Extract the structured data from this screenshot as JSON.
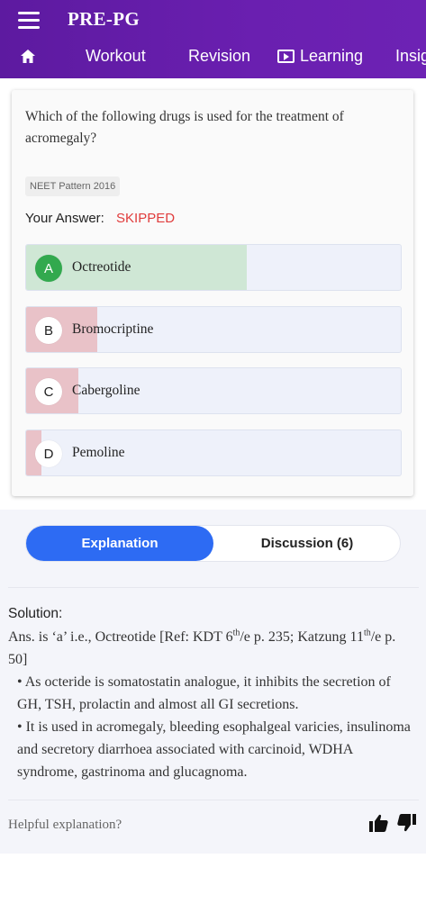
{
  "header": {
    "title": "PRE-PG",
    "tabs": [
      {
        "icon": "home-icon",
        "label": ""
      },
      {
        "label": "Workout"
      },
      {
        "label": "Revision"
      },
      {
        "icon": "play-screen-icon",
        "label": "Learning"
      },
      {
        "label": "Insig"
      }
    ]
  },
  "question": {
    "text": "Which of the following drugs is used for the treatment of acromegaly?",
    "tag": "NEET Pattern 2016",
    "your_answer_label": "Your Answer:",
    "your_answer_status": "SKIPPED",
    "options": [
      {
        "letter": "A",
        "text": "Octreotide",
        "correct": true,
        "percent": 59
      },
      {
        "letter": "B",
        "text": "Bromocriptine",
        "correct": false,
        "percent": 19
      },
      {
        "letter": "C",
        "text": "Cabergoline",
        "correct": false,
        "percent": 14
      },
      {
        "letter": "D",
        "text": "Pemoline",
        "correct": false,
        "percent": 4
      }
    ]
  },
  "toggle": {
    "explanation": "Explanation",
    "discussion": "Discussion (6)"
  },
  "solution": {
    "title": "Solution:",
    "ans_prefix": "Ans. is ‘a’ i.e., Octreotide [Ref: KDT 6",
    "ans_sup1": "th",
    "ans_mid": "/e p. 235; Katzung 11",
    "ans_sup2": "th",
    "ans_suffix": "/e p. 50]",
    "bullet1": "• As octeride is somatostatin analogue, it inhibits the secretion of GH, TSH, prolactin and almost all GI secretions.",
    "bullet2": "• It is used in acromegaly, bleeding esophalgeal varicies, insulinoma and secretory diarrhoea associated with carcinoid, WDHA syndrome, gastrinoma and glucagnoma."
  },
  "feedback": {
    "label": "Helpful explanation?",
    "up_icon": "thumbs-up-icon",
    "down_icon": "thumbs-down-icon"
  },
  "colors": {
    "header": "#6a1fb0",
    "correct_fill": "#cfe7d5",
    "wrong_fill": "#e9c2c8",
    "correct_badge": "#32a94e",
    "skipped": "#e03c3c",
    "active_toggle": "#2d6bf3"
  }
}
